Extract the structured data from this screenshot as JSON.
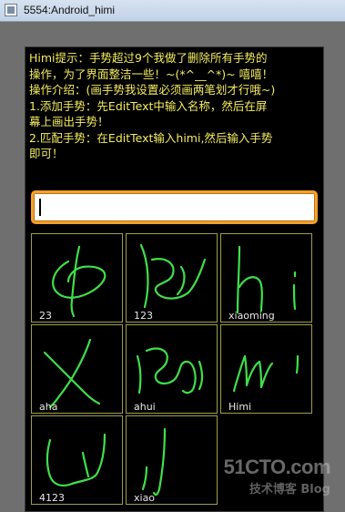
{
  "window": {
    "title": "5554:Android_himi",
    "icon": "emulator-app-icon"
  },
  "hint": {
    "lines": [
      "Himi提示：手势超过9个我做了删除所有手势的",
      "操作，为了界面整洁一些！~(*^__^*)~ 嘻嘻！",
      "操作介绍：(画手势我设置必须画两笔划才行哦~)",
      "1.添加手势：先EditText中输入名称，然后在屏",
      "幕上画出手势！",
      "2.匹配手势：在EditText输入himi,然后输入手势",
      "即可！"
    ]
  },
  "edit_text": {
    "value": "",
    "placeholder": ""
  },
  "gestures": [
    {
      "name": "23"
    },
    {
      "name": "123"
    },
    {
      "name": "xiaoming"
    },
    {
      "name": "aha"
    },
    {
      "name": "ahui"
    },
    {
      "name": "Himi"
    },
    {
      "name": "4123"
    },
    {
      "name": "xiao"
    }
  ],
  "watermark": {
    "big": "51CTO.com",
    "small": "技术博客  Blog"
  },
  "colors": {
    "hint_text": "#f5ec60",
    "gesture_stroke": "#3fe04a",
    "cell_border": "#9e9e4a",
    "edit_focus": "#f2a12a",
    "screen_bg": "#000000"
  }
}
